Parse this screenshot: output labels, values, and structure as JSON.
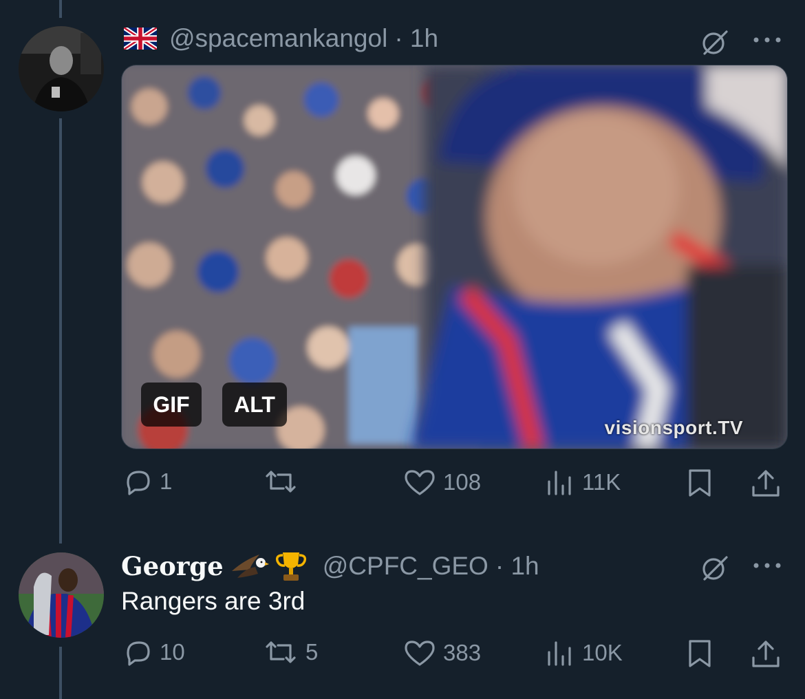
{
  "tweets": [
    {
      "handle": "@spacemankangol",
      "time": "· 1h",
      "flag_icon": "uk-flag-icon",
      "media": {
        "badge_gif": "GIF",
        "badge_alt": "ALT",
        "watermark": "visionsport.TV"
      },
      "actions": {
        "replies": "1",
        "retweets": "",
        "likes": "108",
        "views": "11K"
      }
    },
    {
      "display_name": "George",
      "name_emojis": [
        "eagle-icon",
        "trophy-icon"
      ],
      "handle": "@CPFC_GEO",
      "time": "· 1h",
      "text": "Rangers are 3rd",
      "actions": {
        "replies": "10",
        "retweets": "5",
        "likes": "383",
        "views": "10K"
      }
    }
  ],
  "colors": {
    "background": "#15202b",
    "muted": "#8b98a5",
    "thread_line": "#3d4f63"
  }
}
